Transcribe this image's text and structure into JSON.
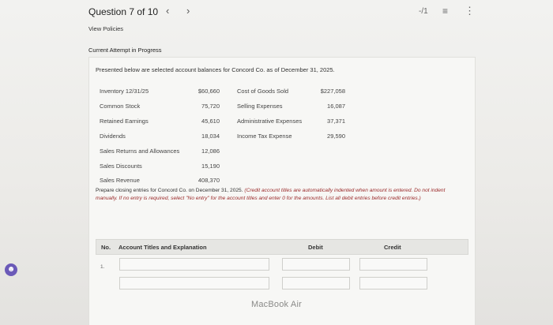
{
  "header": {
    "question_title": "Question 7 of 10",
    "prev_icon": "chevron-left-icon",
    "next_icon": "chevron-right-icon",
    "progress": "-/1",
    "list_icon": "list-icon",
    "more_icon": "more-vertical-icon"
  },
  "view_policies": "View Policies",
  "attempt_status": "Current Attempt in Progress",
  "intro_text": "Presented below are selected account balances for Concord Co. as of December 31, 2025.",
  "balances_left": [
    {
      "label": "Inventory 12/31/25",
      "value": "$60,660"
    },
    {
      "label": "Common Stock",
      "value": "75,720"
    },
    {
      "label": "Retained Earnings",
      "value": "45,610"
    },
    {
      "label": "Dividends",
      "value": "18,034"
    },
    {
      "label": "Sales Returns and Allowances",
      "value": "12,086"
    },
    {
      "label": "Sales Discounts",
      "value": "15,190"
    },
    {
      "label": "Sales Revenue",
      "value": "408,370"
    }
  ],
  "balances_right": [
    {
      "label": "Cost of Goods Sold",
      "value": "$227,058"
    },
    {
      "label": "Selling Expenses",
      "value": "16,087"
    },
    {
      "label": "Administrative Expenses",
      "value": "37,371"
    },
    {
      "label": "Income Tax Expense",
      "value": "29,590"
    }
  ],
  "instructions": {
    "plain": "Prepare closing entries for Concord Co. on December 31, 2025. ",
    "emphasis": "(Credit account titles are automatically indented when amount is entered. Do not indent manually. If no entry is required, select \"No entry\" for the account titles and enter 0 for the amounts. List all debit entries before credit entries.)"
  },
  "table": {
    "col_no": "No.",
    "col_title": "Account Titles and Explanation",
    "col_debit": "Debit",
    "col_credit": "Credit",
    "row_number": "1."
  },
  "watermark": "MacBook Air"
}
